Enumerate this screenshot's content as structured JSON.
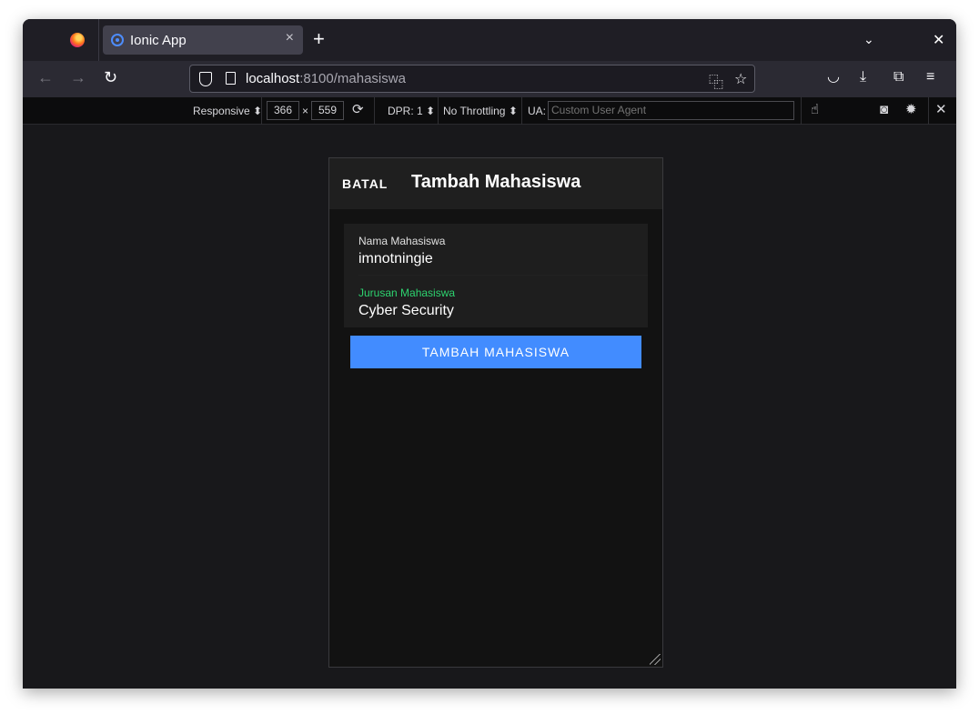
{
  "browser": {
    "tab": {
      "title": "Ionic App",
      "close_icon": "×"
    },
    "new_tab_icon": "+",
    "tabs_menu_icon": "⌄",
    "window_close_icon": "✕",
    "nav": {
      "back": "←",
      "forward": "→",
      "reload": "↻"
    },
    "url": {
      "host": "localhost",
      "rest": ":8100/mahasiswa"
    },
    "toolbar_icons": {
      "translate": "⿻",
      "bookmark": "☆",
      "pocket": "◡",
      "download": "⤓",
      "extensions": "⧉",
      "menu": "≡"
    }
  },
  "devtools": {
    "responsive_label": "Responsive ⬍",
    "width": "366",
    "times": "×",
    "height": "559",
    "rotate_icon": "⟳",
    "dpr_label": "DPR: 1 ⬍",
    "throttling_label": "No Throttling ⬍",
    "ua_label": "UA:",
    "ua_placeholder": "Custom User Agent",
    "touch_icon": "☝",
    "screenshot_icon": "◙",
    "settings_icon": "✹",
    "close_icon": "✕"
  },
  "app": {
    "cancel_label": "BATAL",
    "title": "Tambah Mahasiswa",
    "fields": [
      {
        "label": "Nama Mahasiswa",
        "value": "imnotningie"
      },
      {
        "label": "Jurusan Mahasiswa",
        "value": "Cyber Security"
      }
    ],
    "submit_label": "TAMBAH MAHASISWA"
  },
  "colors": {
    "primary": "#428cff",
    "focused_label": "#2dd36f",
    "app_background": "#121212"
  }
}
